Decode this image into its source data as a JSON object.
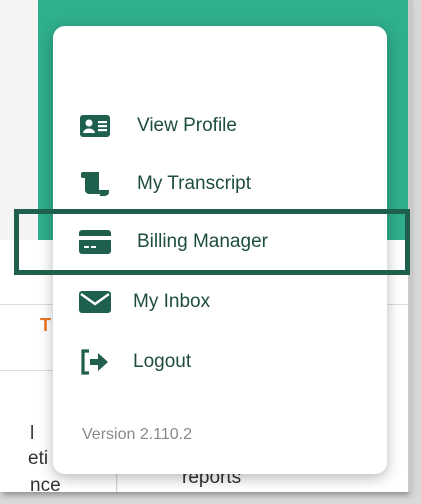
{
  "background": {
    "teal_color": "#2faf8c",
    "left_fragments": [
      "T",
      "l",
      "eti",
      "nce"
    ],
    "right_fragment": "reports"
  },
  "menu": {
    "items": [
      {
        "label": "View Profile",
        "icon": "id-card-icon"
      },
      {
        "label": "My Transcript",
        "icon": "scroll-icon"
      },
      {
        "label": "Billing Manager",
        "icon": "credit-card-icon",
        "highlighted": true
      },
      {
        "label": "My Inbox",
        "icon": "envelope-icon"
      },
      {
        "label": "Logout",
        "icon": "logout-icon"
      }
    ],
    "version": "Version 2.110.2"
  },
  "colors": {
    "icon_green": "#1f5f4e",
    "label_green": "#1e4e3a",
    "highlight_border": "#1f5f4e"
  }
}
